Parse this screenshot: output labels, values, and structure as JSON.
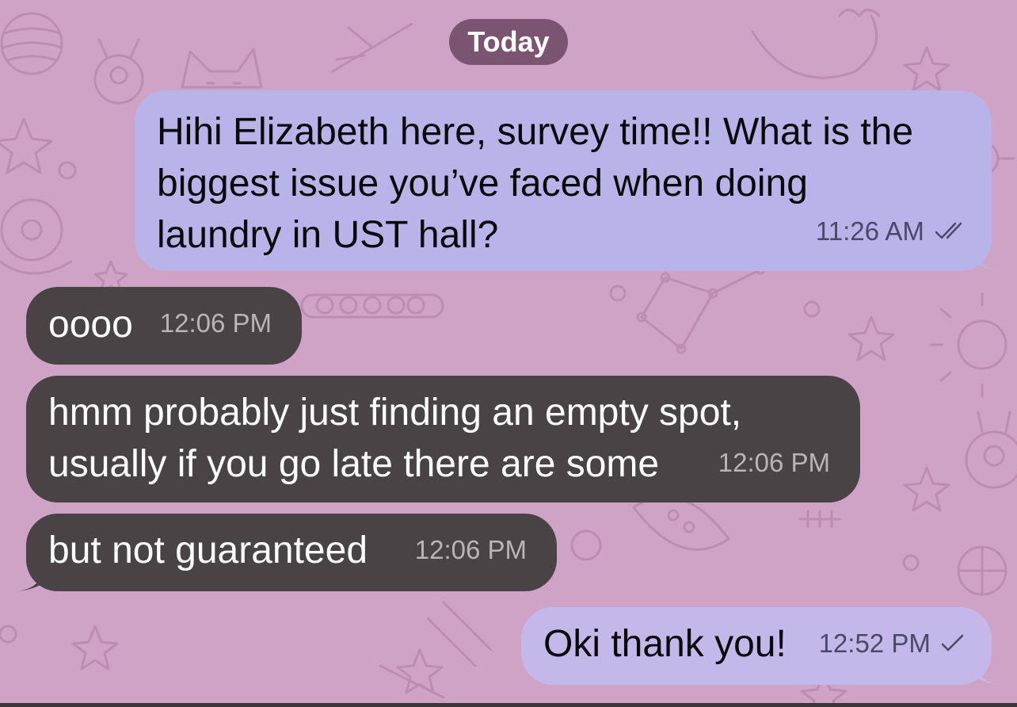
{
  "chat": {
    "date_separator": "Today",
    "messages": [
      {
        "direction": "outgoing",
        "lines": [
          "Hihi Elizabeth here, survey time!! What is the",
          "biggest issue you’ve faced when doing",
          "laundry in UST hall?"
        ],
        "time": "11:26 AM",
        "status_icon": "double-check-icon"
      },
      {
        "direction": "incoming",
        "lines": [
          "oooo"
        ],
        "time": "12:06 PM"
      },
      {
        "direction": "incoming",
        "lines": [
          "hmm probably just finding an empty spot,",
          "usually if you go late there are some"
        ],
        "time": "12:06 PM"
      },
      {
        "direction": "incoming",
        "lines": [
          "but not guaranteed"
        ],
        "time": "12:06 PM"
      },
      {
        "direction": "outgoing",
        "lines": [
          "Oki thank you!"
        ],
        "time": "12:52 PM",
        "status_icon": "single-check-icon"
      }
    ]
  },
  "colors": {
    "wallpaper": "#cfa3c6",
    "date_pill": "#7a5470",
    "outgoing_bubble": "#b8b4ea",
    "incoming_bubble": "#4a4346"
  }
}
